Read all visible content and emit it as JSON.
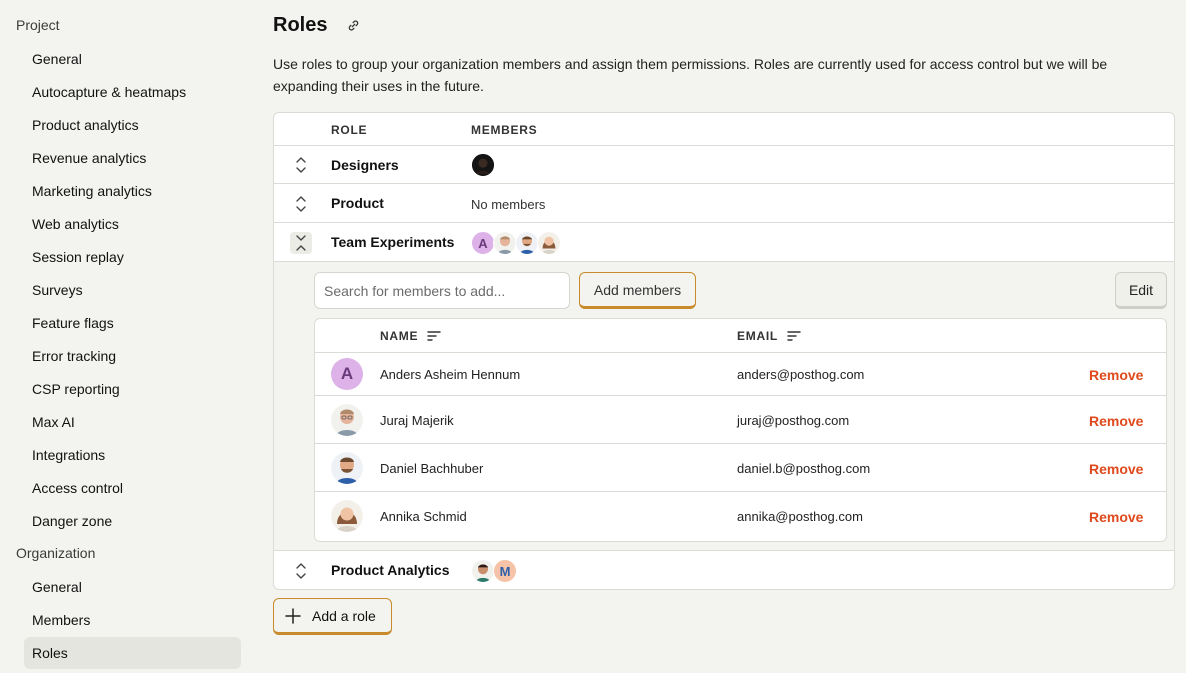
{
  "sidebar": {
    "project_heading": "Project",
    "project_items": [
      {
        "label": "General"
      },
      {
        "label": "Autocapture & heatmaps"
      },
      {
        "label": "Product analytics"
      },
      {
        "label": "Revenue analytics"
      },
      {
        "label": "Marketing analytics"
      },
      {
        "label": "Web analytics"
      },
      {
        "label": "Session replay"
      },
      {
        "label": "Surveys"
      },
      {
        "label": "Feature flags"
      },
      {
        "label": "Error tracking"
      },
      {
        "label": "CSP reporting"
      },
      {
        "label": "Max AI"
      },
      {
        "label": "Integrations"
      },
      {
        "label": "Access control"
      },
      {
        "label": "Danger zone"
      }
    ],
    "org_heading": "Organization",
    "org_items": [
      {
        "label": "General"
      },
      {
        "label": "Members"
      },
      {
        "label": "Roles",
        "active": true
      }
    ]
  },
  "page": {
    "title": "Roles",
    "description": "Use roles to group your organization members and assign them permissions. Roles are currently used for access control but we will be expanding their uses in the future."
  },
  "roles_table": {
    "headers": {
      "role": "ROLE",
      "members": "MEMBERS"
    },
    "roles": [
      {
        "name": "Designers",
        "members": [
          "photo-dark"
        ],
        "expanded": false
      },
      {
        "name": "Product",
        "members_text": "No members",
        "expanded": false
      },
      {
        "name": "Team Experiments",
        "members": [
          "A",
          "photo-juraj",
          "photo-daniel",
          "photo-annika"
        ],
        "expanded": true
      },
      {
        "name": "Product Analytics",
        "members": [
          "photo-man",
          "M"
        ],
        "expanded": false
      }
    ]
  },
  "expanded_role": {
    "search_placeholder": "Search for members to add...",
    "add_members_label": "Add members",
    "edit_label": "Edit",
    "headers": {
      "name": "NAME",
      "email": "EMAIL"
    },
    "members": [
      {
        "avatar": "A",
        "name": "Anders Asheim Hennum",
        "email": "anders@posthog.com",
        "action": "Remove"
      },
      {
        "avatar": "photo-juraj",
        "name": "Juraj Majerik",
        "email": "juraj@posthog.com",
        "action": "Remove"
      },
      {
        "avatar": "photo-daniel",
        "name": "Daniel Bachhuber",
        "email": "daniel.b@posthog.com",
        "action": "Remove"
      },
      {
        "avatar": "photo-annika",
        "name": "Annika Schmid",
        "email": "annika@posthog.com",
        "action": "Remove"
      }
    ]
  },
  "add_role_label": "Add a role",
  "colors": {
    "accent": "#c88a2a",
    "danger": "#e0491b",
    "background": "#f3f4ef"
  }
}
